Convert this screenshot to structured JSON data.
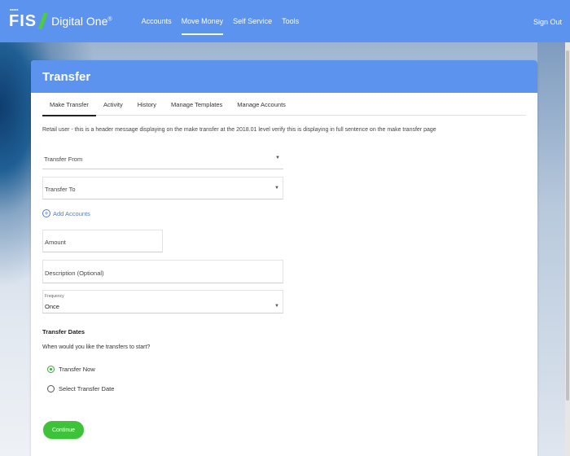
{
  "brand": {
    "logo_text": "FIS",
    "logo_dots": "•••••",
    "product_name": "Digital One",
    "product_mark": "®",
    "accent_color": "#5b93ef",
    "brand_green": "#4bcd3e"
  },
  "nav": {
    "items": [
      {
        "label": "Accounts"
      },
      {
        "label": "Move Money",
        "active": true
      },
      {
        "label": "Self Service"
      },
      {
        "label": "Tools"
      }
    ],
    "signout_label": "Sign Out"
  },
  "card": {
    "title": "Transfer",
    "tabs": [
      {
        "label": "Make Transfer",
        "active": true
      },
      {
        "label": "Activity"
      },
      {
        "label": "History"
      },
      {
        "label": "Manage Templates"
      },
      {
        "label": "Manage Accounts"
      }
    ],
    "header_message": "Retail user - this is a header message displaying on the make transfer at the  2018.01 level verify this is displaying in full sentence on the make transfer page"
  },
  "form": {
    "transfer_from": {
      "placeholder": "Transfer From",
      "icon": "caret-down-icon"
    },
    "transfer_to": {
      "placeholder": "Transfer To",
      "icon": "caret-down-icon"
    },
    "add_accounts": {
      "label": "Add Accounts",
      "icon": "plus-circle-icon"
    },
    "amount": {
      "placeholder": "Amount"
    },
    "description": {
      "placeholder": "Description (Optional)"
    },
    "frequency": {
      "label": "Frequency",
      "value": "Once",
      "icon": "caret-down-icon"
    },
    "transfer_dates": {
      "title": "Transfer Dates",
      "question": "When would you like the transfers to start?",
      "options": [
        {
          "label": "Transfer Now",
          "checked": true
        },
        {
          "label": "Select Transfer Date",
          "checked": false
        }
      ]
    },
    "continue_label": "Continue"
  }
}
